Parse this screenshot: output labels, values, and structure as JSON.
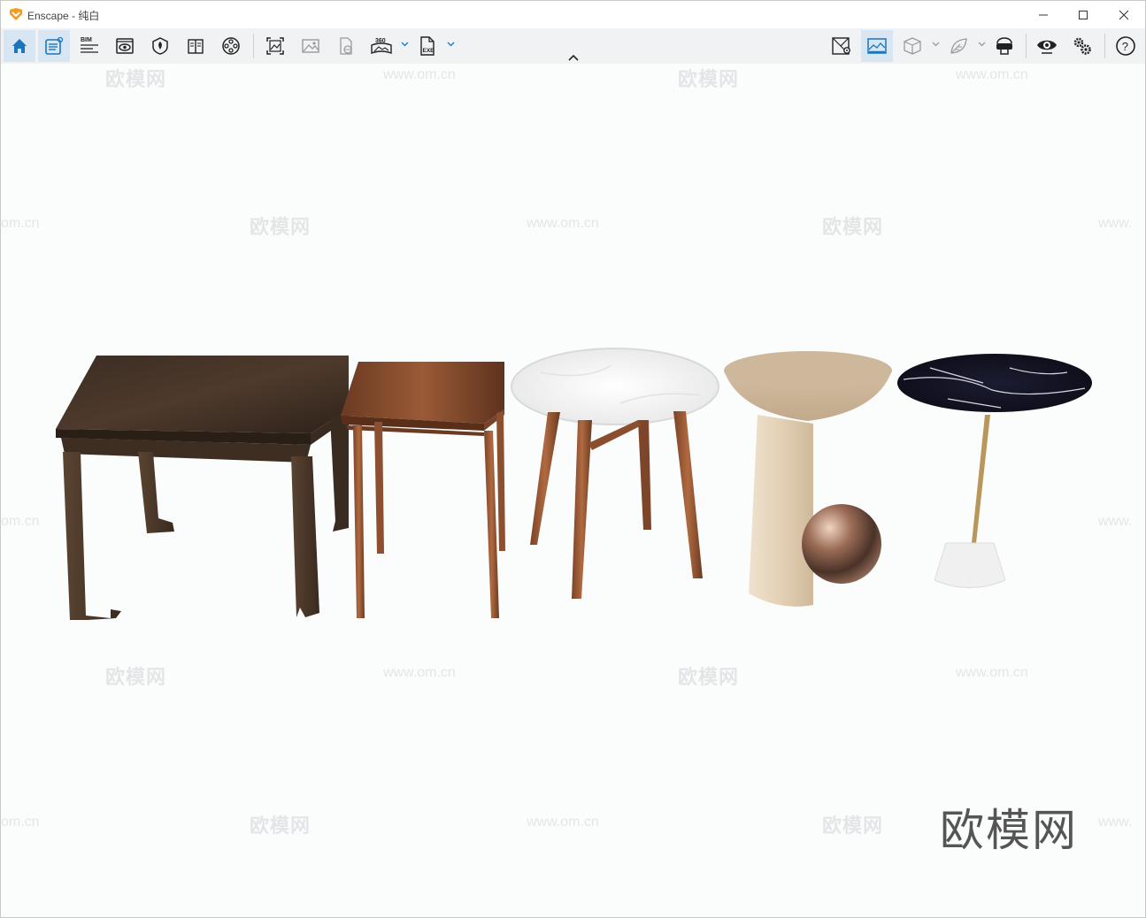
{
  "window": {
    "app_name": "Enscape",
    "title_separator": " - ",
    "document": "纯白"
  },
  "toolbar": {
    "left": [
      {
        "name": "home-button",
        "icon": "home-icon",
        "active": true
      },
      {
        "name": "sketch-button",
        "icon": "sketch-icon",
        "active": true
      },
      {
        "name": "bim-button",
        "icon": "bim-icon",
        "label": "BIM"
      },
      {
        "name": "views-button",
        "icon": "eye-monitor-icon"
      },
      {
        "name": "sections-button",
        "icon": "shield-icon"
      },
      {
        "name": "manual-button",
        "icon": "book-icon"
      },
      {
        "name": "video-button",
        "icon": "film-reel-icon"
      },
      {
        "name": "screenshot-button",
        "icon": "screenshot-icon"
      },
      {
        "name": "batch-render-button",
        "icon": "image-icon"
      },
      {
        "name": "web-standalone-button",
        "icon": "file-globe-icon"
      },
      {
        "name": "panorama-button",
        "icon": "panorama-360-icon",
        "label": "360"
      },
      {
        "name": "export-exe-button",
        "icon": "exe-file-icon",
        "label": "EXE"
      }
    ],
    "right": [
      {
        "name": "map-button",
        "icon": "map-icon"
      },
      {
        "name": "atmosphere-button",
        "icon": "landscape-icon",
        "active": true
      },
      {
        "name": "asset-library-button",
        "icon": "cube-icon"
      },
      {
        "name": "materials-button",
        "icon": "leaf-icon"
      },
      {
        "name": "vr-headset-button",
        "icon": "vr-headset-icon"
      },
      {
        "name": "visual-settings-button",
        "icon": "eye-icon"
      },
      {
        "name": "settings-button",
        "icon": "gears-icon"
      },
      {
        "name": "help-button",
        "icon": "help-circle-icon",
        "label": "?"
      }
    ]
  },
  "watermarks": {
    "logo_text": "欧模网",
    "url_text": "www.om.cn",
    "url_partial_left": "om.cn",
    "url_partial_right": "www."
  },
  "colors": {
    "accent": "#1b75bc",
    "viewport_bg": "#fbfdfd",
    "logo_orange": "#f39c1e"
  }
}
